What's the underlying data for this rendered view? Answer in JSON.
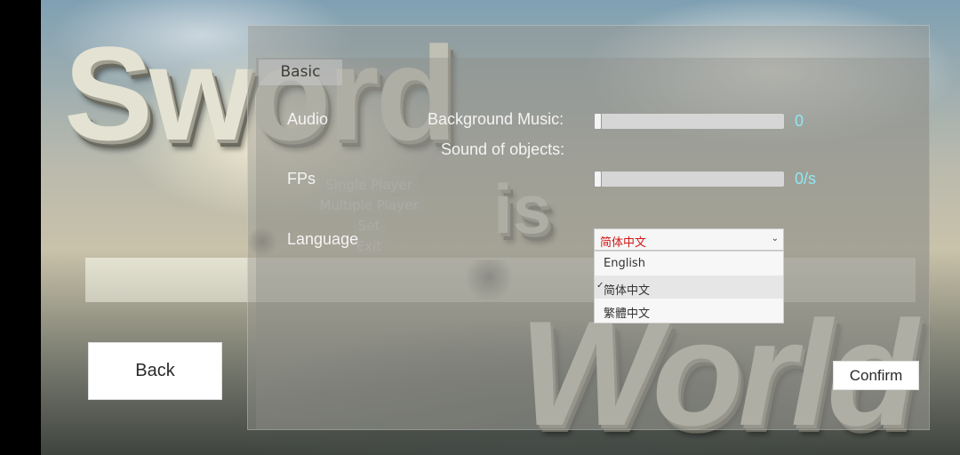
{
  "title_art": {
    "word1": "Sword",
    "word2": "is",
    "word3": "World"
  },
  "main_menu": {
    "single_player": "Single Player",
    "multiple_player": "Multiple Player",
    "set": "Set",
    "exit": "Exit"
  },
  "settings": {
    "tab_basic": "Basic",
    "audio_label": "Audio",
    "bgm_label": "Background Music:",
    "sound_label": "Sound of objects:",
    "bgm_value": "0",
    "bgm_level": 0,
    "fps_label": "FPs",
    "fps_value": "0/s",
    "fps_level": 0,
    "language_label": "Language",
    "language_selected": "简体中文",
    "language_options": [
      "English",
      "简体中文",
      "繁體中文"
    ],
    "language_selected_index": 1
  },
  "buttons": {
    "back": "Back",
    "confirm": "Confirm"
  },
  "colors": {
    "value_text": "#8fe8f4",
    "selected_language": "#d01818"
  }
}
